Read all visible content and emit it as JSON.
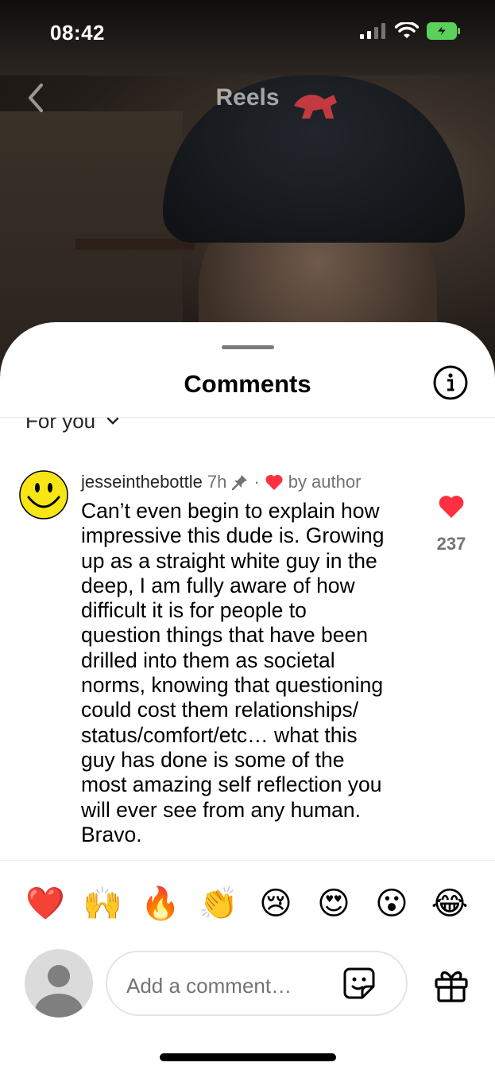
{
  "status_bar": {
    "time": "08:42"
  },
  "video": {
    "title": "Reels"
  },
  "sheet": {
    "title": "Comments",
    "filter_label": "For you"
  },
  "comment": {
    "username": "jesseinthebottle",
    "age": "7h",
    "liked_by": "by author",
    "lines": [
      "Can’t even begin to explain how",
      "impressive this dude is. Growing",
      "up as a straight white guy in the",
      "deep, I am fully aware of how",
      "difficult it is for people to",
      "question things that have been",
      "drilled into them as societal",
      "norms, knowing that questioning",
      "could cost them relationships/",
      "status/comfort/etc… what this",
      "guy has done is some of the",
      "most amazing self reflection you",
      "will ever see from any human.",
      "Bravo."
    ],
    "like_count": "237"
  },
  "reactions": [
    "❤️",
    "🙌",
    "🔥",
    "👏",
    "😢",
    "😍",
    "😮",
    "😂"
  ],
  "composer": {
    "placeholder": "Add a comment…"
  },
  "colors": {
    "like_red": "#ff3040",
    "text_secondary": "#737373"
  }
}
